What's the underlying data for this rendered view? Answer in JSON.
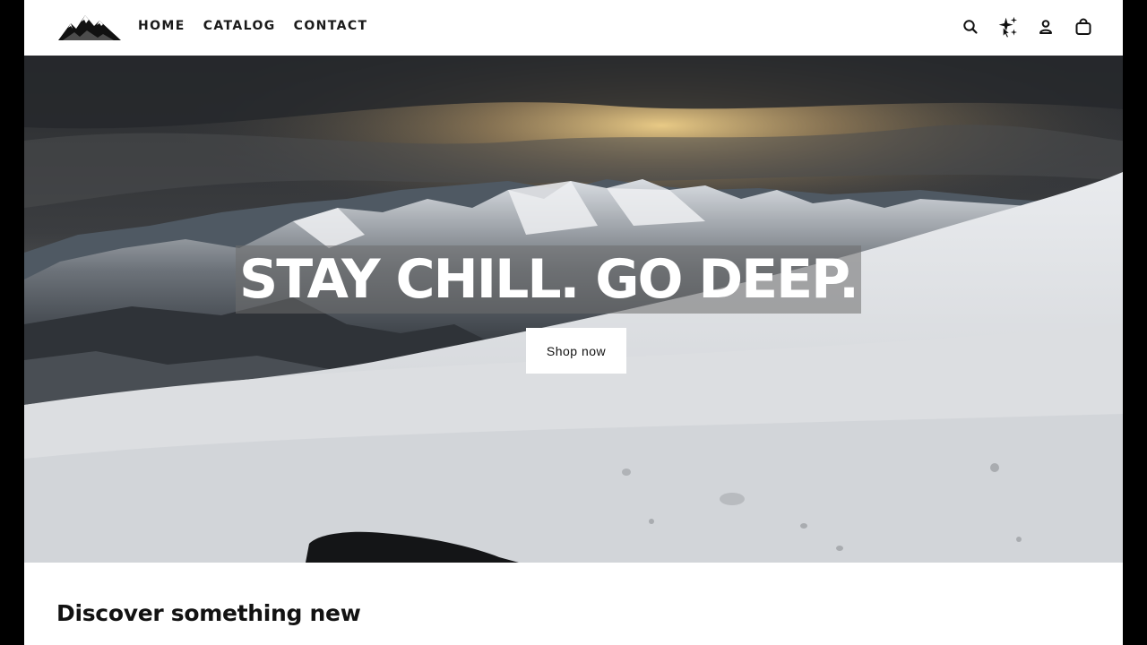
{
  "header": {
    "logo_icon": "mountain-logo-icon",
    "nav": [
      {
        "label": "HOME"
      },
      {
        "label": "CATALOG"
      },
      {
        "label": "CONTACT"
      }
    ],
    "icons": [
      "search-icon",
      "sparkles-icon",
      "account-icon",
      "cart-icon"
    ]
  },
  "hero": {
    "title": "STAY CHILL. GO DEEP.",
    "button_label": "Shop now"
  },
  "featured": {
    "heading": "Discover something new"
  },
  "colors": {
    "background": "#000000",
    "page": "#ffffff",
    "text": "#121212",
    "title_backdrop": "#6e6e6e"
  }
}
